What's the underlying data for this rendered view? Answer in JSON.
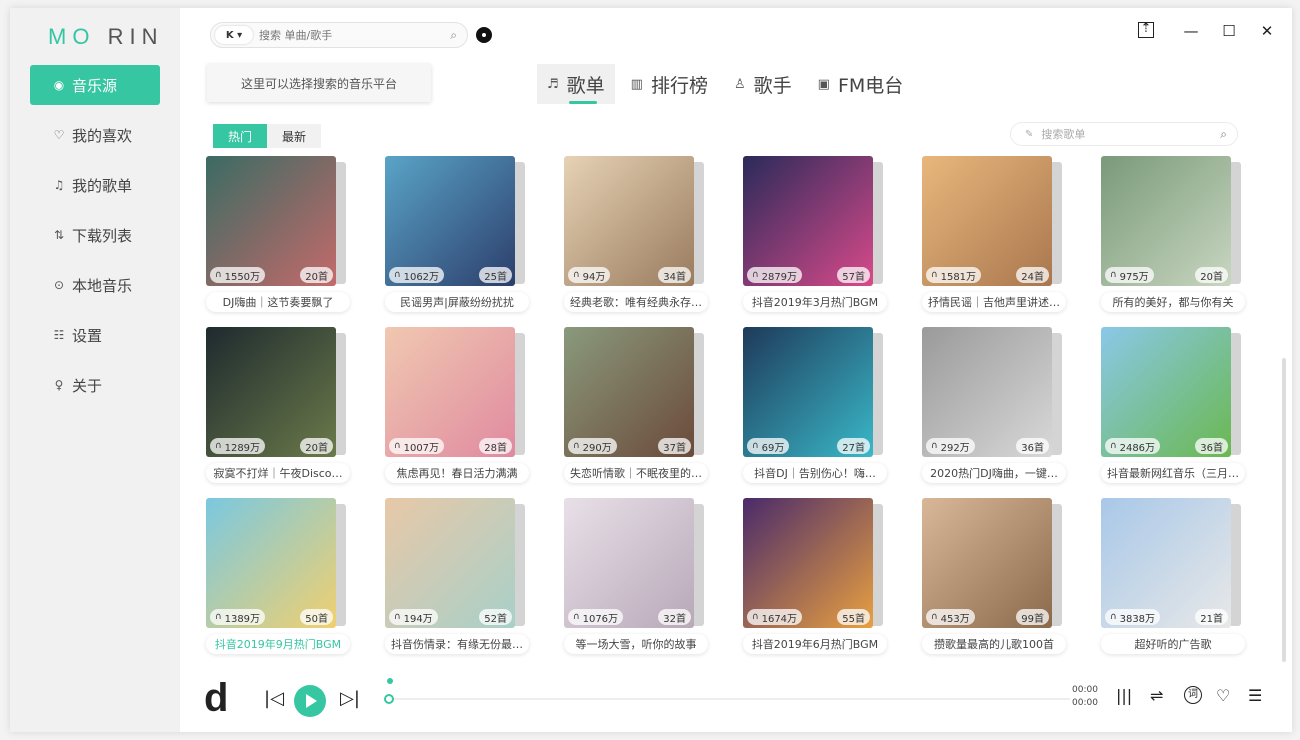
{
  "app": {
    "logo_a": "MO",
    "logo_b": "RIN"
  },
  "sidebar": {
    "items": [
      {
        "label": "音乐源",
        "icon": "disc-icon",
        "glyph": "◉"
      },
      {
        "label": "我的喜欢",
        "icon": "heart-icon",
        "glyph": "♡"
      },
      {
        "label": "我的歌单",
        "icon": "music-list-icon",
        "glyph": "♫"
      },
      {
        "label": "下载列表",
        "icon": "download-icon",
        "glyph": "⇅"
      },
      {
        "label": "本地音乐",
        "icon": "play-circle-icon",
        "glyph": "⊙"
      },
      {
        "label": "设置",
        "icon": "settings-icon",
        "glyph": "☷"
      },
      {
        "label": "关于",
        "icon": "bulb-icon",
        "glyph": "♀"
      }
    ]
  },
  "search": {
    "platform": "K ▾",
    "placeholder": "搜索 单曲/歌手",
    "tooltip": "这里可以选择搜索的音乐平台"
  },
  "tabs": [
    {
      "label": "歌单",
      "icon": "playlist-icon",
      "glyph": "♬"
    },
    {
      "label": "排行榜",
      "icon": "chart-icon",
      "glyph": "▥"
    },
    {
      "label": "歌手",
      "icon": "singer-icon",
      "glyph": "♙"
    },
    {
      "label": "FM电台",
      "icon": "radio-icon",
      "glyph": "▣"
    }
  ],
  "filters": {
    "hot": "热门",
    "new": "最新"
  },
  "playlist_search": {
    "placeholder": "搜索歌单"
  },
  "cards": [
    {
      "plays": "1550万",
      "songs": "20首",
      "title": "DJ嗨曲｜这节奏要飘了",
      "c1": "#3a6b63",
      "c2": "#c46a6a"
    },
    {
      "plays": "1062万",
      "songs": "25首",
      "title": "民谣男声|屏蔽纷纷扰扰",
      "c1": "#5aa4c8",
      "c2": "#2c3e6b"
    },
    {
      "plays": "94万",
      "songs": "34首",
      "title": "经典老歌：唯有经典永存…",
      "c1": "#e6d2b5",
      "c2": "#9a7b5e"
    },
    {
      "plays": "2879万",
      "songs": "57首",
      "title": "抖音2019年3月热门BGM",
      "c1": "#2a2a5a",
      "c2": "#d84a8a"
    },
    {
      "plays": "1581万",
      "songs": "24首",
      "title": "抒情民谣｜吉他声里讲述…",
      "c1": "#e8b77c",
      "c2": "#a9774e"
    },
    {
      "plays": "975万",
      "songs": "20首",
      "title": "所有的美好，都与你有关",
      "c1": "#7a9a7a",
      "c2": "#c8d6c0"
    },
    {
      "plays": "1289万",
      "songs": "20首",
      "title": "寂寞不打烊｜午夜Disco…",
      "c1": "#1e2a2e",
      "c2": "#6b7a4a"
    },
    {
      "plays": "1007万",
      "songs": "28首",
      "title": "焦虑再见！春日活力满满",
      "c1": "#f0c8b0",
      "c2": "#e08aa0"
    },
    {
      "plays": "290万",
      "songs": "37首",
      "title": "失恋听情歌｜不眠夜里的…",
      "c1": "#8a9a7c",
      "c2": "#6b4a3a"
    },
    {
      "plays": "69万",
      "songs": "27首",
      "title": "抖音DJ｜告别伤心！嗨…",
      "c1": "#1e3a5a",
      "c2": "#3ab8c8"
    },
    {
      "plays": "292万",
      "songs": "36首",
      "title": "2020热门DJ嗨曲，一键…",
      "c1": "#9a9a9a",
      "c2": "#d8d8d8"
    },
    {
      "plays": "2486万",
      "songs": "36首",
      "title": "抖音最新网红音乐（三月…",
      "c1": "#8ac8e8",
      "c2": "#6ab850"
    },
    {
      "plays": "1389万",
      "songs": "50首",
      "title": "抖音2019年9月热门BGM",
      "c1": "#7ac8e0",
      "c2": "#f0d070",
      "highlight": true
    },
    {
      "plays": "194万",
      "songs": "52首",
      "title": "抖音伤情录：有缘无份最…",
      "c1": "#e8c8a8",
      "c2": "#a8d0c8"
    },
    {
      "plays": "1076万",
      "songs": "32首",
      "title": "等一场大雪，听你的故事",
      "c1": "#e8e0e8",
      "c2": "#b8a8b8"
    },
    {
      "plays": "1674万",
      "songs": "55首",
      "title": "抖音2019年6月热门BGM",
      "c1": "#4a2a6a",
      "c2": "#e8a040"
    },
    {
      "plays": "453万",
      "songs": "99首",
      "title": "攒歌量最高的儿歌100首",
      "c1": "#d8b898",
      "c2": "#8a6a4a"
    },
    {
      "plays": "3838万",
      "songs": "21首",
      "title": "超好听的广告歌",
      "c1": "#a8c8e8",
      "c2": "#e8e8e8"
    }
  ],
  "player": {
    "logo": "d",
    "time_current": "00:00",
    "time_total": "00:00",
    "lyrics_label": "词"
  },
  "colors": {
    "accent": "#36c6a2"
  }
}
